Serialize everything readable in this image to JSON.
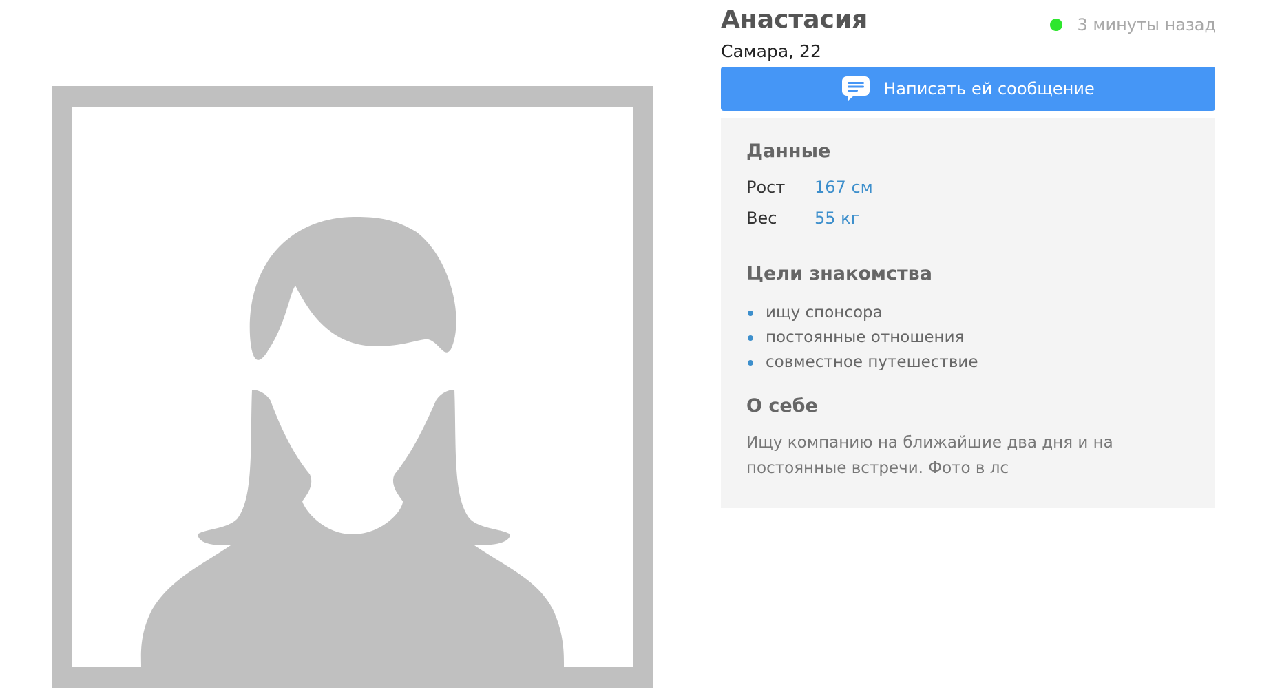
{
  "profile": {
    "name": "Анастасия",
    "city_age": "Самара, 22",
    "status_text": "3 минуты назад",
    "status_color": "#2ee62e",
    "photo_icon": "female-avatar-placeholder-icon"
  },
  "actions": {
    "message_label": "Написать ей сообщение",
    "message_color": "#4596f6",
    "message_icon": "chat-bubble-icon"
  },
  "details": {
    "title": "Данные",
    "rows": [
      {
        "label": "Рост",
        "value": "167 см"
      },
      {
        "label": "Вес",
        "value": "55 кг"
      }
    ]
  },
  "goals": {
    "title": "Цели знакомства",
    "items": [
      "ищу спонсора",
      "постоянные отношения",
      "совместное путешествие"
    ]
  },
  "about": {
    "title": "О себе",
    "text": "Ищу компанию на ближайшие два дня и на постоянные встречи. Фото в лс"
  },
  "colors": {
    "accent": "#3d8fcc",
    "panel_bg": "#f4f4f4",
    "placeholder_gray": "#c0c0c0"
  }
}
